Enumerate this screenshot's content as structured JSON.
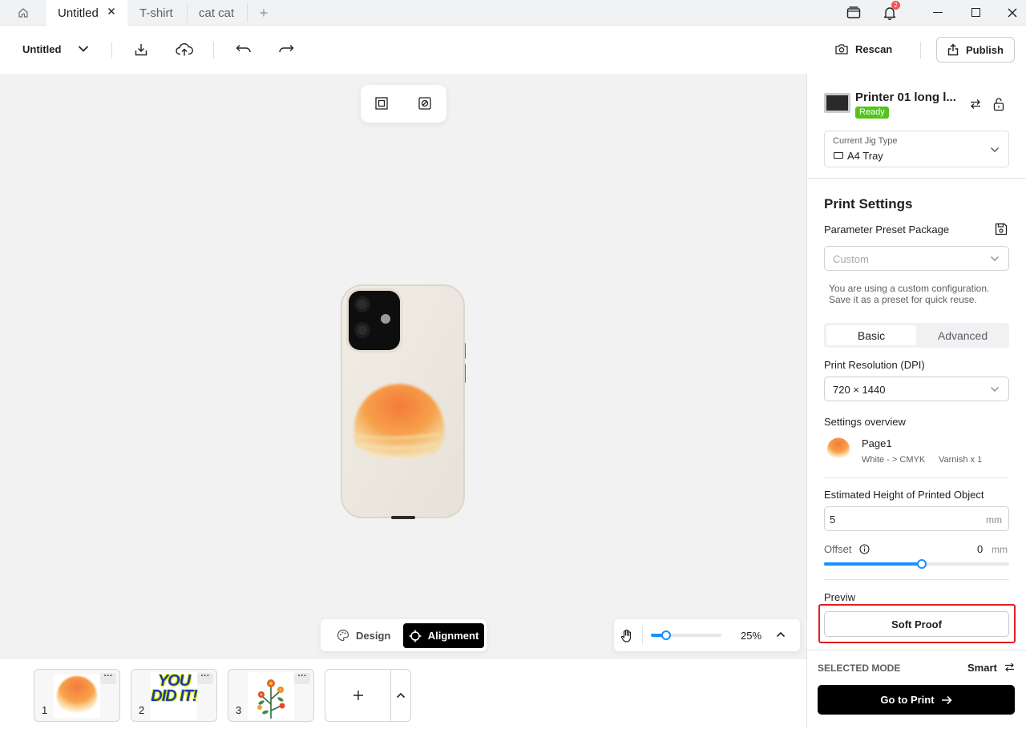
{
  "tabs": [
    {
      "label": "Untitled",
      "active": true
    },
    {
      "label": "T-shirt",
      "active": false
    },
    {
      "label": "cat cat",
      "active": false
    }
  ],
  "tabbar": {
    "notification_count": "2"
  },
  "toolbar": {
    "doc_name": "Untitled",
    "rescan_label": "Rescan",
    "publish_label": "Publish"
  },
  "canvas": {
    "mode_tabs": [
      {
        "label": "Design",
        "active": false
      },
      {
        "label": "Alignment",
        "active": true
      }
    ],
    "zoom_label": "25%",
    "zoom_fraction": 0.22
  },
  "pages": [
    {
      "number": "1",
      "more": "···",
      "thumb": "sunset-blur"
    },
    {
      "number": "2",
      "more": "···",
      "thumb": "you-did-it",
      "text": "YOU DID IT!"
    },
    {
      "number": "3",
      "more": "···",
      "thumb": "flowers"
    }
  ],
  "printer": {
    "name": "Printer 01 long l...",
    "status": "Ready",
    "status_color": "#52c41a"
  },
  "jig": {
    "label": "Current Jig Type",
    "value": "A4 Tray"
  },
  "settings": {
    "title": "Print Settings",
    "preset_label": "Parameter Preset Package",
    "preset_placeholder": "Custom",
    "preset_note": "You are using a custom configuration. Save it as a preset for quick reuse.",
    "tab_basic": "Basic",
    "tab_advanced": "Advanced",
    "resolution_label": "Print Resolution (DPI)",
    "resolution_value": "720 × 1440",
    "overview_label": "Settings overview",
    "overview_page": "Page1",
    "overview_channels": "White - > CMYK",
    "overview_varnish": "Varnish x 1",
    "height_label": "Estimated Height of Printed Object",
    "height_value": "5",
    "height_unit": "mm",
    "offset_label": "Offset",
    "offset_value": "0",
    "offset_unit": "mm",
    "offset_fraction": 0.53,
    "preview_label": "Previw",
    "soft_proof_label": "Soft Proof"
  },
  "footer": {
    "mode_label": "SELECTED MODE",
    "mode_value": "Smart",
    "go_to_print": "Go to Print"
  },
  "colors": {
    "accent": "#1890ff",
    "highlight": "#e02020",
    "ready": "#52c41a",
    "primary_button": "#000000"
  }
}
